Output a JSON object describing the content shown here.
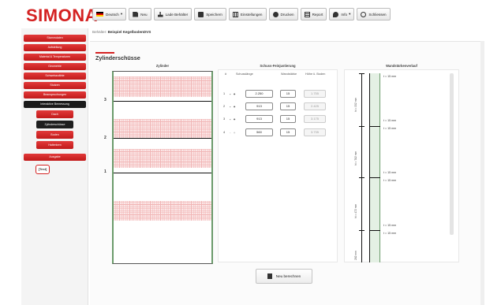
{
  "app": {
    "logo": "SIMONA"
  },
  "toolbar": {
    "language": "Deutsch",
    "buttons": [
      {
        "label": "Neu",
        "icon": "new-document-icon"
      },
      {
        "label": "Lade Behälter",
        "icon": "load-icon"
      },
      {
        "label": "Speichern",
        "icon": "save-icon"
      },
      {
        "label": "Einstellungen",
        "icon": "settings-icon"
      },
      {
        "label": "Drucken",
        "icon": "print-icon"
      },
      {
        "label": "Report",
        "icon": "report-icon"
      },
      {
        "label": "Info",
        "icon": "info-icon"
      },
      {
        "label": "Schliessen",
        "icon": "power-icon"
      }
    ]
  },
  "breadcrumb": {
    "prefix": "Behälter:",
    "name": "Beispiel KegelbodenDVS"
  },
  "sidebar": {
    "items": [
      {
        "label": "Stammdaten"
      },
      {
        "label": "Aufstellung"
      },
      {
        "label": "Material & Temperaturen"
      },
      {
        "label": "Geometrie"
      },
      {
        "label": "Schweissnähte"
      },
      {
        "label": "Stutzen"
      },
      {
        "label": "Beanspruchungen"
      },
      {
        "label": "Interaktive Bemessung"
      }
    ],
    "subitems": [
      {
        "label": "Dach"
      },
      {
        "label": "Zylinderschüsse"
      },
      {
        "label": "Boden"
      },
      {
        "label": "Halterkern"
      }
    ],
    "ausgabe": "Ausgabe",
    "test": "[Test]"
  },
  "main": {
    "title": "Zylinderschüsse",
    "col_zylinder": "Zylinder",
    "col_fine": "Schuss-Feinjustierung",
    "col_wall": "Wandstärkenverlauf",
    "table_headers": {
      "num": "#",
      "length": "Schusslänge",
      "thickness": "Wandstärke",
      "height": "Höhe ü. Boden"
    },
    "rows": [
      {
        "num": "1",
        "ctrl": "- +",
        "length": "2.250",
        "thickness": "15",
        "height": "1.755"
      },
      {
        "num": "2",
        "ctrl": "- +",
        "length": "913",
        "thickness": "15",
        "height": "2.425"
      },
      {
        "num": "3",
        "ctrl": "- +",
        "length": "913",
        "thickness": "15",
        "height": "3.175"
      },
      {
        "num": "4",
        "ctrl": "- +",
        "length": "560",
        "thickness": "15",
        "height": "3.735"
      }
    ],
    "shell_numbers": [
      "3",
      "2",
      "1"
    ],
    "wall_labels": [
      "t = 15 mm",
      "t = 15 mm",
      "t = 15 mm",
      "t = 15 mm",
      "t = 15 mm",
      "t = 15 mm",
      "t = 15 mm"
    ],
    "dim_labels": [
      "hi = 332 mm",
      "hi = 782 mm",
      "hi = 472 mm",
      "282 mm"
    ],
    "calc_button": "Neu berechnen"
  }
}
